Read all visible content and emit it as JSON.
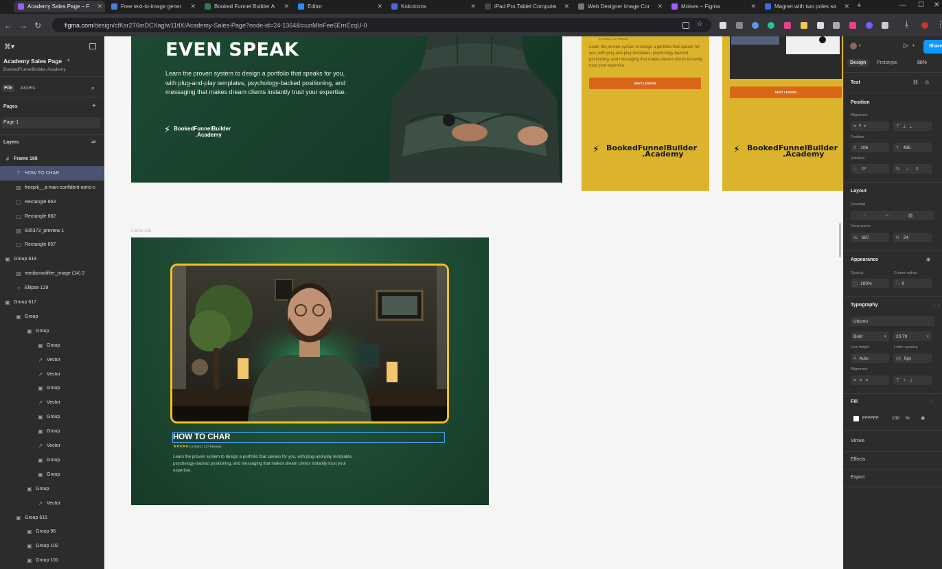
{
  "browser": {
    "tabs": [
      {
        "title": "Academy Sales Page – Fig",
        "color": "#a259ff",
        "active": true
      },
      {
        "title": "Free text-to-image gener",
        "color": "#4a7fd6",
        "active": false
      },
      {
        "title": "Booked Funnel Builder A",
        "color": "#2f7d4f",
        "active": false
      },
      {
        "title": "Editor",
        "color": "#2d8cf0",
        "active": false
      },
      {
        "title": "Kokoicons",
        "color": "#4a6ad6",
        "active": false
      },
      {
        "title": "iPad Pro Tablet Computer",
        "color": "#444444",
        "active": false
      },
      {
        "title": "Web Designer Image Cor",
        "color": "#777777",
        "active": false
      },
      {
        "title": "Moises – Figma",
        "color": "#a259ff",
        "active": false
      },
      {
        "title": "Magnet with two poles sa",
        "color": "#3a6be0",
        "active": false
      }
    ],
    "url_host": "figma.com",
    "url_path": "/design/cfKsr2T6mDCXagIw11tlX/Academy-Sales-Page?node-id=24-1364&t=unMInFee6ErnEcqU-0"
  },
  "left_panel": {
    "file_name": "Academy Sales Page",
    "team_name": "BookedFunnelBuilder.Academy",
    "tab_file": "File",
    "tab_assets": "Assets",
    "pages_header": "Pages",
    "page_1": "Page 1",
    "layers_header": "Layers",
    "layers": [
      {
        "name": "Frame 198",
        "icon": "#",
        "indent": 0,
        "bold": true
      },
      {
        "name": "HOW TO CHAR",
        "icon": "T",
        "indent": 1,
        "selected": true
      },
      {
        "name": "freepik__a-man-confident-arms-c",
        "icon": "▨",
        "indent": 1
      },
      {
        "name": "Rectangle 663",
        "icon": "▢",
        "indent": 1
      },
      {
        "name": "Rectangle 662",
        "icon": "▢",
        "indent": 1
      },
      {
        "name": "835373_preview 1",
        "icon": "▨",
        "indent": 1
      },
      {
        "name": "Rectangle 657",
        "icon": "▢",
        "indent": 1
      },
      {
        "name": "Group 619",
        "icon": "▣",
        "indent": 0
      },
      {
        "name": "mediamodifier_image (14) 2",
        "icon": "▨",
        "indent": 1
      },
      {
        "name": "Ellipse 129",
        "icon": "○",
        "indent": 1
      },
      {
        "name": "Group 617",
        "icon": "▣",
        "indent": 0
      },
      {
        "name": "Group",
        "icon": "▣",
        "indent": 1
      },
      {
        "name": "Group",
        "icon": "▣",
        "indent": 2
      },
      {
        "name": "Group",
        "icon": "▣",
        "indent": 3
      },
      {
        "name": "Vector",
        "icon": "↗",
        "indent": 3
      },
      {
        "name": "Vector",
        "icon": "↗",
        "indent": 3
      },
      {
        "name": "Group",
        "icon": "▣",
        "indent": 3
      },
      {
        "name": "Vector",
        "icon": "↗",
        "indent": 3
      },
      {
        "name": "Group",
        "icon": "▣",
        "indent": 3
      },
      {
        "name": "Group",
        "icon": "▣",
        "indent": 3
      },
      {
        "name": "Vector",
        "icon": "↗",
        "indent": 3
      },
      {
        "name": "Group",
        "icon": "▣",
        "indent": 3
      },
      {
        "name": "Group",
        "icon": "▣",
        "indent": 3
      },
      {
        "name": "Group",
        "icon": "▣",
        "indent": 2
      },
      {
        "name": "Vector",
        "icon": "↗",
        "indent": 3
      },
      {
        "name": "Group 615",
        "icon": "▣",
        "indent": 1
      },
      {
        "name": "Group 96",
        "icon": "▣",
        "indent": 2
      },
      {
        "name": "Group 102",
        "icon": "▣",
        "indent": 2
      },
      {
        "name": "Group 101",
        "icon": "▣",
        "indent": 2
      }
    ]
  },
  "canvas": {
    "hero_title": "EVEN SPEAK",
    "hero_body": "Learn the proven system to design a portfolio that speaks for you, with plug-and-play templates, psychology-backed positioning, and messaging that makes dream clients instantly trust your expertise.",
    "brand_line1": "BookedFunnelBuilder",
    "brand_line2": ".Academy",
    "card_rating": "4.9 Stars | 127 Reviews",
    "card_body": "Learn the proven system to design a portfolio that speaks for you, with plug-and-play templates, psychology-backed positioning, and messaging that makes dream clients instantly trust your expertise.",
    "card_button": "NEXT LESSON",
    "frame_label": "Frame 198",
    "headline": "HOW TO CHAR",
    "rating": "4.9 Stars | 127 Reviews",
    "body": "Learn the proven system to design a portfolio that speaks for you, with plug-and-play templates, psychology-backed positioning, and messaging that makes dream clients instantly trust your expertise."
  },
  "right_panel": {
    "share": "Share",
    "tab_design": "Design",
    "tab_prototype": "Prototype",
    "zoom": "88%",
    "section_text": "Text",
    "position_header": "Position",
    "alignment_label": "Alignment",
    "position_label": "Position",
    "x_label": "X",
    "x": "106",
    "y_label": "Y",
    "y": "495",
    "rotation_label": "Rotation",
    "rotation": "0°",
    "layout_header": "Layout",
    "resizing_label": "Resizing",
    "dimensions_label": "Dimensions",
    "w_label": "W",
    "w": "687",
    "h_label": "H",
    "h": "24",
    "appearance_header": "Appearance",
    "opacity_label": "Opacity",
    "opacity": "100%",
    "corner_label": "Corner radius",
    "corner": "0",
    "typography_header": "Typography",
    "font": "Ubuntu",
    "weight": "Bold",
    "size": "20.79",
    "line_height_label": "Line height",
    "line_height": "Auto",
    "letter_spacing_label": "Letter spacing",
    "letter_spacing": "0px",
    "align_label": "Alignment",
    "fill_header": "Fill",
    "fill_hex": "FFFFFF",
    "fill_opacity": "100",
    "fill_pct": "%",
    "stroke_header": "Stroke",
    "effects_header": "Effects",
    "export_header": "Export"
  },
  "colors": {
    "accent": "#0d99ff",
    "selection": "#4a5370",
    "gold": "#f5c21b",
    "orange": "#d9661a"
  }
}
